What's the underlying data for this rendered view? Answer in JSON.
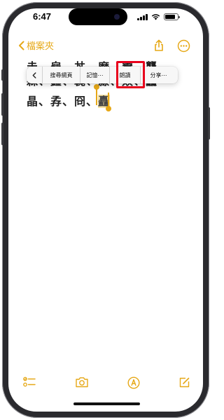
{
  "status_bar": {
    "time": "6:47",
    "signal_bars": 3,
    "battery_level": 0.85
  },
  "nav": {
    "back_label": "檔案夾",
    "back_icon": "chevron-left-icon",
    "share_icon": "share-icon",
    "more_icon": "ellipsis-circle-icon"
  },
  "note": {
    "line1": "圭、龜、丼、磨、鬻、龘、",
    "line2": "森、鑫、毳、淼、焱、龘",
    "line3_prefix": "晶、孨、冏、",
    "selected_text": "矗"
  },
  "context_menu": {
    "prev_icon": "chevron-left-icon",
    "search_web": "搜尋網頁",
    "remember": "記憶⋯",
    "speak": "朗讀",
    "share": "分享⋯"
  },
  "toolbar": {
    "checklist_icon": "checklist-icon",
    "camera_icon": "camera-icon",
    "markup_icon": "markup-pen-icon",
    "compose_icon": "compose-icon"
  },
  "colors": {
    "accent": "#e6a817",
    "selection": "#f7e3a6",
    "highlight_box": "#e8001c",
    "menu_background": "#f7f7f7"
  }
}
